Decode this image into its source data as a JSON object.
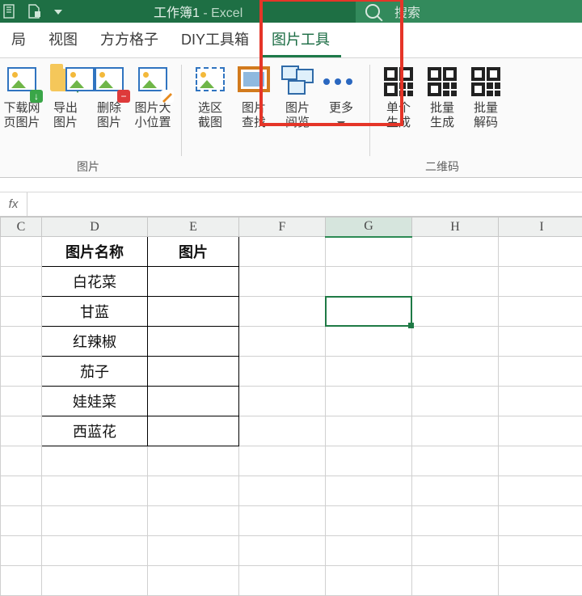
{
  "title_bar": {
    "doc_name": "工作簿1",
    "suffix": " - Excel",
    "search_placeholder": "搜索"
  },
  "ribbon_tabs": [
    "局",
    "视图",
    "方方格子",
    "DIY工具箱",
    "图片工具"
  ],
  "ribbon_active_index": 4,
  "ribbon_groups": {
    "pic_group_label": "图片",
    "qr_group_label": "二维码",
    "buttons": {
      "dl_web": "下载网\n页图片",
      "export": "导出\n图片",
      "delete": "删除\n图片",
      "size_pos": "图片大\n小位置",
      "sel_shot": "选区\n截图",
      "pic_find": "图片\n查找",
      "pic_view": "图片\n阅览",
      "more": "更多",
      "qr_single": "单个\n生成",
      "qr_batch": "批量\n生成",
      "qr_decode": "批量\n解码"
    }
  },
  "formula_bar": {
    "fx_label": "fx",
    "value": ""
  },
  "columns": [
    "C",
    "D",
    "E",
    "F",
    "G",
    "H",
    "I"
  ],
  "selected_column_index": 4,
  "table": {
    "headers": [
      "图片名称",
      "图片"
    ],
    "rows": [
      "白花菜",
      "甘蓝",
      "红辣椒",
      "茄子",
      "娃娃菜",
      "西蓝花"
    ]
  },
  "selection": {
    "cell": "G4"
  }
}
